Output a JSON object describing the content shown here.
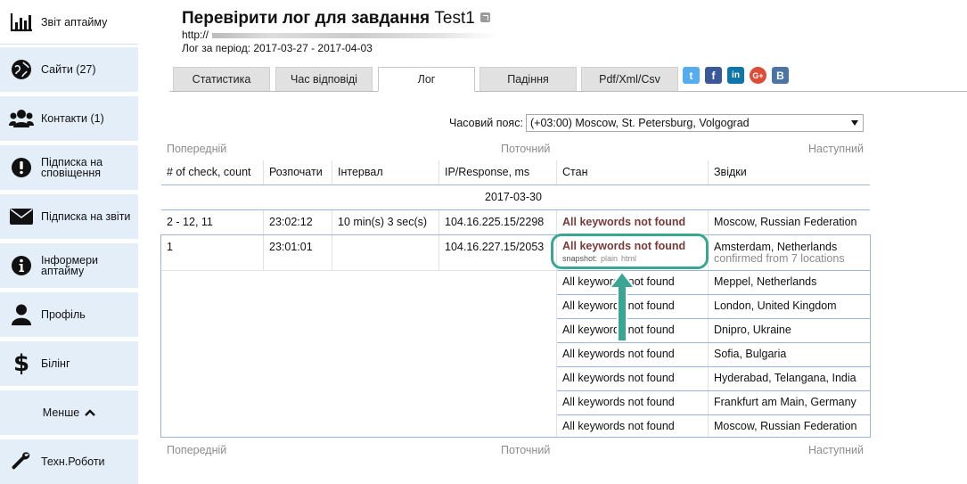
{
  "sidebar": {
    "items": [
      {
        "label": "Звіт аптайму",
        "icon": "bar-chart-icon"
      },
      {
        "label": "Сайти (27)",
        "icon": "globe-icon"
      },
      {
        "label": "Контакти (1)",
        "icon": "users-icon"
      },
      {
        "label": "Підписка на сповіщення",
        "icon": "exclamation-icon"
      },
      {
        "label": "Підписка на звіти",
        "icon": "envelope-icon"
      },
      {
        "label": "Інформери аптайму",
        "icon": "info-icon"
      },
      {
        "label": "Профіль",
        "icon": "user-icon"
      },
      {
        "label": "Білінг",
        "icon": "dollar-icon"
      },
      {
        "label": "Менше",
        "icon": "chevron-up-icon"
      },
      {
        "label": "Техн.Роботи",
        "icon": "wrench-icon"
      }
    ]
  },
  "header": {
    "title": "Перевірити лог для завдання",
    "task_name": "Test1",
    "url_prefix": "http://",
    "period": "Лог за період: 2017-03-27 - 2017-04-03"
  },
  "tabs": [
    {
      "label": "Статистика"
    },
    {
      "label": "Час відповіді"
    },
    {
      "label": "Лог"
    },
    {
      "label": "Падіння"
    },
    {
      "label": "Pdf/Xml/Csv"
    }
  ],
  "social": [
    {
      "icon": "twitter-icon",
      "glyph": "t",
      "color": "#55acee"
    },
    {
      "icon": "facebook-icon",
      "glyph": "f",
      "color": "#3b5998"
    },
    {
      "icon": "linkedin-icon",
      "glyph": "in",
      "color": "#0e76a8"
    },
    {
      "icon": "google-plus-icon",
      "glyph": "G+",
      "color": "#dd4b39"
    },
    {
      "icon": "vk-icon",
      "glyph": "B",
      "color": "#4c75a3"
    }
  ],
  "timezone": {
    "label": "Часовий пояс:",
    "value": "(+03:00) Moscow, St. Petersburg, Volgograd"
  },
  "pagination": {
    "prev": "Попередній",
    "current": "Поточний",
    "next": "Наступний"
  },
  "table": {
    "columns": [
      "# of check, count",
      "Розпочати",
      "Інтервал",
      "IP/Response, ms",
      "Стан",
      "Звідки"
    ],
    "date_group": "2017-03-30",
    "row1": {
      "check": "2 - 12, 11",
      "start": "23:02:12",
      "interval": "10 min(s) 3 sec(s)",
      "ip": "104.16.225.15/2298",
      "status": "All keywords not found",
      "from": "Moscow, Russian Federation"
    },
    "row2": {
      "check": "1",
      "start": "23:01:01",
      "ip": "104.16.227.15/2053",
      "status": "All keywords not found",
      "snapshot_label": "snapshot:",
      "snapshot_plain": "plain",
      "snapshot_html": "html",
      "from": "Amsterdam, Netherlands",
      "confirmed": "confirmed from 7 locations"
    },
    "locations": [
      {
        "status": "All keywords not found",
        "from": "Meppel, Netherlands"
      },
      {
        "status": "All keywords not found",
        "from": "London, United Kingdom"
      },
      {
        "status": "All keywords not found",
        "from": "Dnipro, Ukraine"
      },
      {
        "status": "All keywords not found",
        "from": "Sofia, Bulgaria"
      },
      {
        "status": "All keywords not found",
        "from": "Hyderabad, Telangana, India"
      },
      {
        "status": "All keywords not found",
        "from": "Frankfurt am Main, Germany"
      },
      {
        "status": "All keywords not found",
        "from": "Moscow, Russian Federation"
      }
    ]
  },
  "colors": {
    "accent_arrow": "#3aa590",
    "sidebar_bg": "#e3eef9",
    "status_text": "#7a3a3a"
  }
}
